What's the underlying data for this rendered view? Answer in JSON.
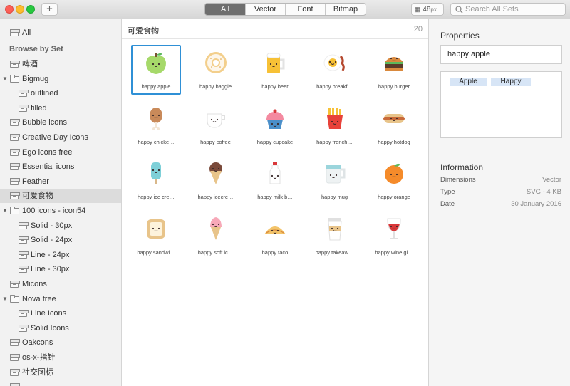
{
  "toolbar": {
    "add_label": "+",
    "tabs": [
      "All",
      "Vector",
      "Font",
      "Bitmap"
    ],
    "active_tab": "All",
    "size_value": "48",
    "size_unit": "px",
    "search_placeholder": "Search All Sets"
  },
  "sidebar": {
    "all_label": "All",
    "section_label": "Browse by Set",
    "items": [
      {
        "label": "啤酒",
        "type": "box",
        "indent": 0
      },
      {
        "label": "Bigmug",
        "type": "folder",
        "indent": 0,
        "expanded": true
      },
      {
        "label": "outlined",
        "type": "box",
        "indent": 1
      },
      {
        "label": "filled",
        "type": "box",
        "indent": 1
      },
      {
        "label": "Bubble icons",
        "type": "box",
        "indent": 0
      },
      {
        "label": "Creative Day Icons",
        "type": "box",
        "indent": 0
      },
      {
        "label": "Ego icons free",
        "type": "box",
        "indent": 0
      },
      {
        "label": "Essential icons",
        "type": "box",
        "indent": 0
      },
      {
        "label": "Feather",
        "type": "box",
        "indent": 0
      },
      {
        "label": "可爱食物",
        "type": "box",
        "indent": 0,
        "selected": true
      },
      {
        "label": "100 icons - icon54",
        "type": "folder",
        "indent": 0,
        "expanded": true
      },
      {
        "label": "Solid - 30px",
        "type": "box",
        "indent": 1
      },
      {
        "label": "Solid - 24px",
        "type": "box",
        "indent": 1
      },
      {
        "label": "Line - 24px",
        "type": "box",
        "indent": 1
      },
      {
        "label": "Line - 30px",
        "type": "box",
        "indent": 1
      },
      {
        "label": "Micons",
        "type": "box",
        "indent": 0
      },
      {
        "label": "Nova free",
        "type": "folder",
        "indent": 0,
        "expanded": true
      },
      {
        "label": "Line Icons",
        "type": "box",
        "indent": 1
      },
      {
        "label": "Solid Icons",
        "type": "box",
        "indent": 1
      },
      {
        "label": "Oakcons",
        "type": "box",
        "indent": 0
      },
      {
        "label": "os-x-指针",
        "type": "box",
        "indent": 0
      },
      {
        "label": "社交图标",
        "type": "box",
        "indent": 0
      },
      {
        "label": "",
        "type": "box",
        "indent": 0
      }
    ]
  },
  "main": {
    "title": "可爱食物",
    "count": "20",
    "icons": [
      {
        "caption": "happy apple",
        "icon": "apple-icon",
        "selected": true
      },
      {
        "caption": "happy baggle",
        "icon": "bagel-icon"
      },
      {
        "caption": "happy beer",
        "icon": "beer-icon"
      },
      {
        "caption": "happy breakf…",
        "icon": "breakfast-icon"
      },
      {
        "caption": "happy burger",
        "icon": "burger-icon"
      },
      {
        "caption": "happy chicke…",
        "icon": "chicken-icon"
      },
      {
        "caption": "happy coffee",
        "icon": "coffee-icon"
      },
      {
        "caption": "happy cupcake",
        "icon": "cupcake-icon"
      },
      {
        "caption": "happy french…",
        "icon": "fries-icon"
      },
      {
        "caption": "happy hotdog",
        "icon": "hotdog-icon"
      },
      {
        "caption": "happy ice cre…",
        "icon": "popsicle-icon"
      },
      {
        "caption": "happy icecre…",
        "icon": "icecream-cone-icon"
      },
      {
        "caption": "happy milk b…",
        "icon": "milk-bottle-icon"
      },
      {
        "caption": "happy mug",
        "icon": "mug-icon"
      },
      {
        "caption": "happy orange",
        "icon": "orange-icon"
      },
      {
        "caption": "happy sandwi…",
        "icon": "sandwich-icon"
      },
      {
        "caption": "happy soft ic…",
        "icon": "soft-icecream-icon"
      },
      {
        "caption": "happy taco",
        "icon": "taco-icon"
      },
      {
        "caption": "happy takeaw…",
        "icon": "takeaway-cup-icon"
      },
      {
        "caption": "happy wine gl…",
        "icon": "wine-glass-icon"
      }
    ]
  },
  "properties": {
    "title": "Properties",
    "name_value": "happy apple",
    "tags": [
      "Apple",
      "Happy"
    ]
  },
  "information": {
    "title": "Information",
    "rows": [
      {
        "key": "Dimensions",
        "value": "Vector"
      },
      {
        "key": "Type",
        "value": "SVG - 4 KB"
      },
      {
        "key": "Date",
        "value": "30 January 2016"
      }
    ]
  },
  "colors": {
    "selection_border": "#2f90d6",
    "tag_bg": "#d7e5f6",
    "active_tab_bg": "#6e6e6e"
  }
}
